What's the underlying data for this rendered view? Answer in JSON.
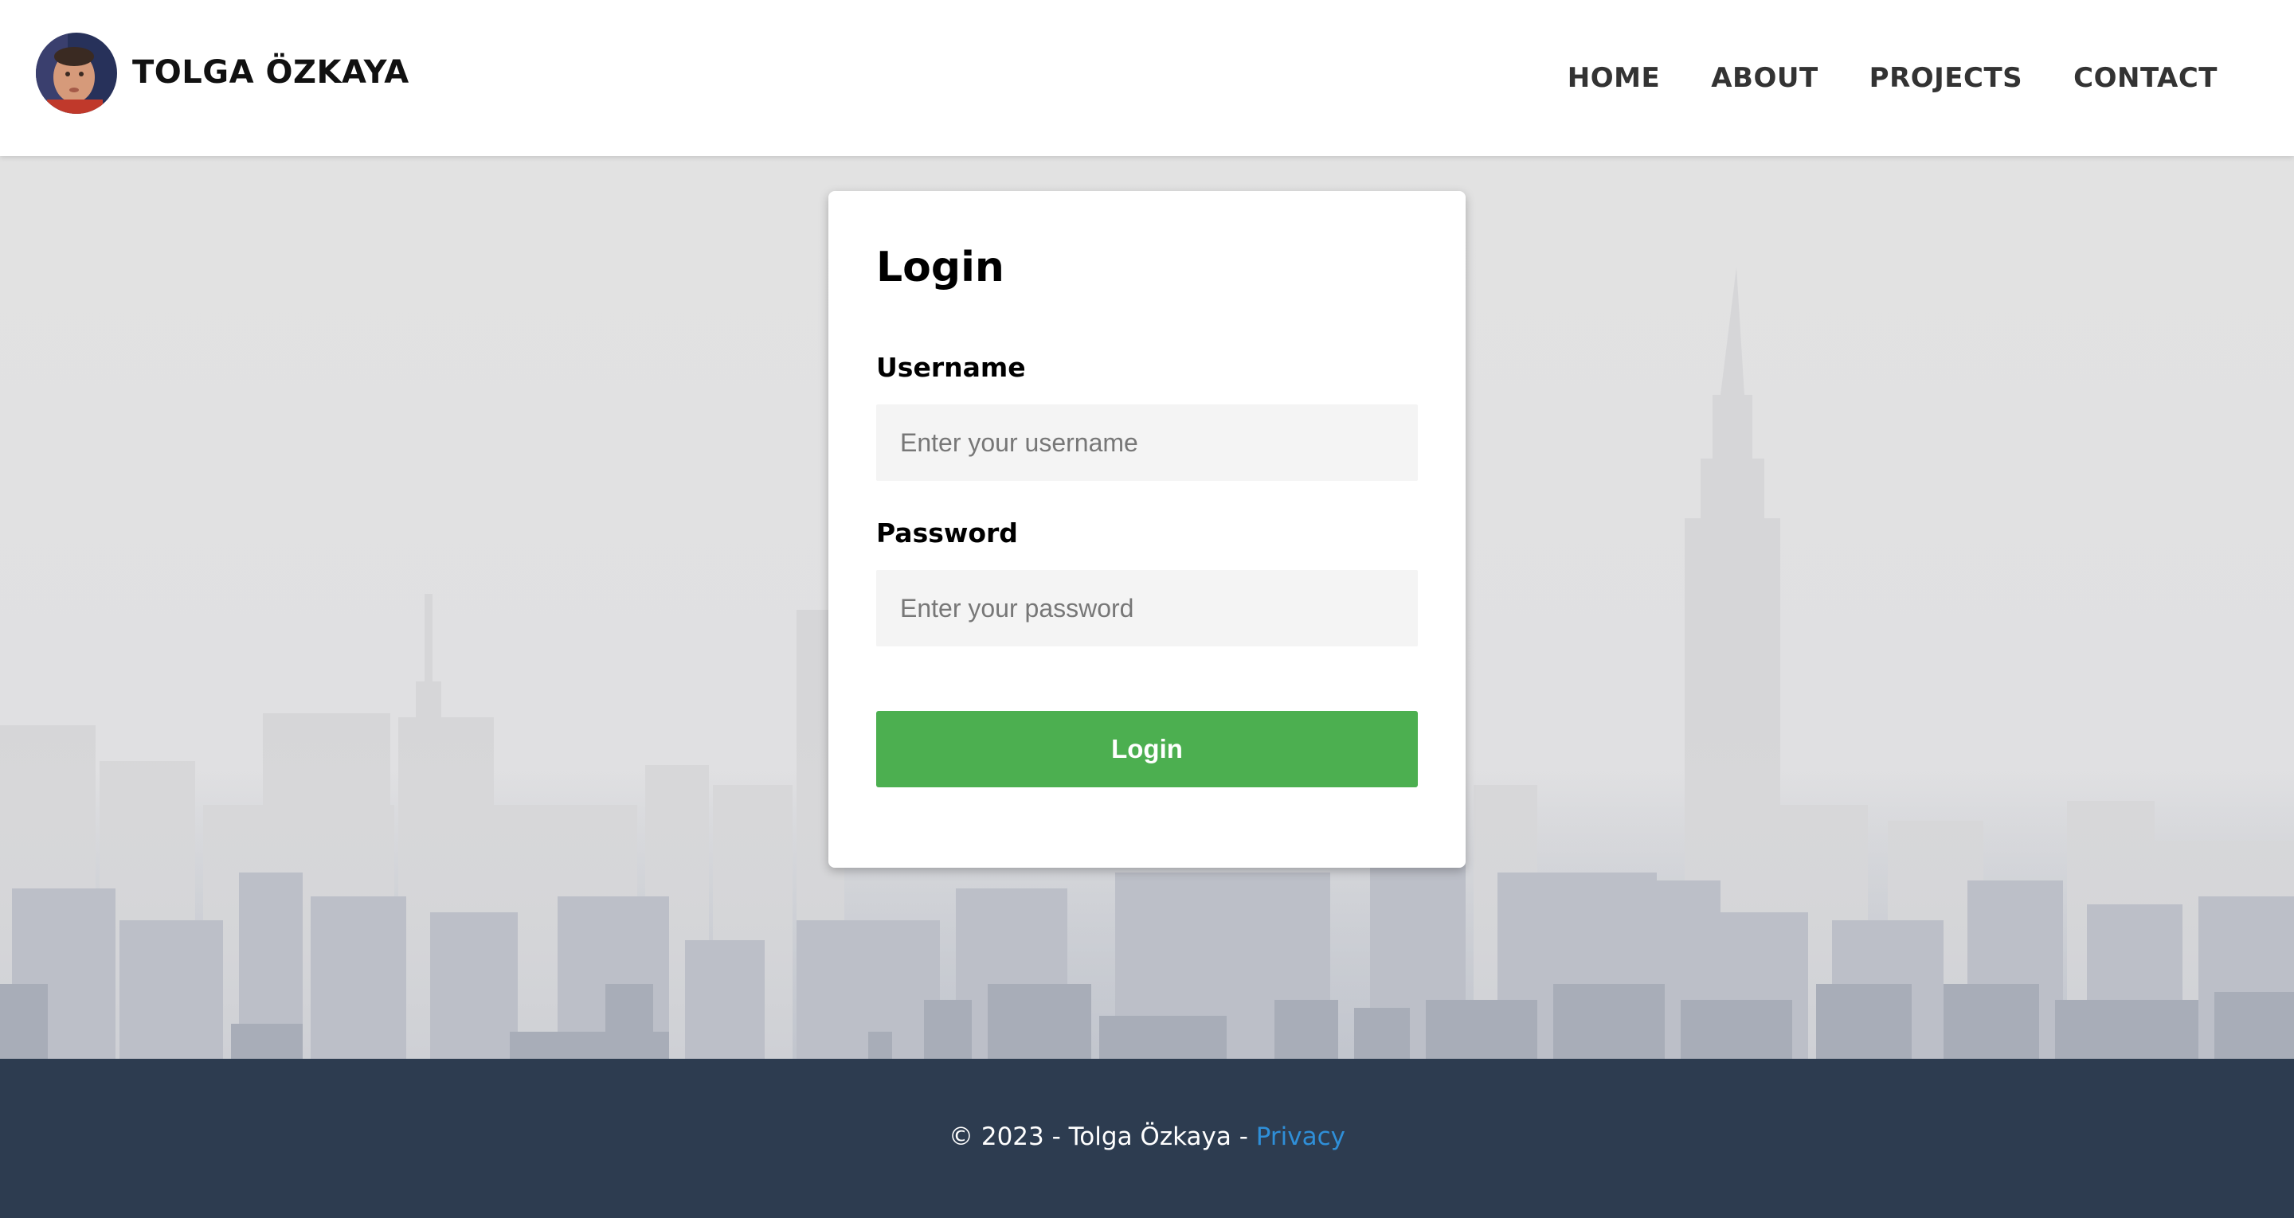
{
  "header": {
    "brand": "TOLGA ÖZKAYA",
    "nav": [
      {
        "label": "HOME"
      },
      {
        "label": "ABOUT"
      },
      {
        "label": "PROJECTS"
      },
      {
        "label": "CONTACT"
      }
    ]
  },
  "login": {
    "title": "Login",
    "username_label": "Username",
    "username_placeholder": "Enter your username",
    "password_label": "Password",
    "password_placeholder": "Enter your password",
    "submit_label": "Login"
  },
  "footer": {
    "copyright": "© 2023 - Tolga Özkaya - ",
    "privacy_link": "Privacy"
  },
  "colors": {
    "accent_button": "#4caf50",
    "footer_bg": "#2d3c50",
    "link": "#2f8fd8"
  }
}
